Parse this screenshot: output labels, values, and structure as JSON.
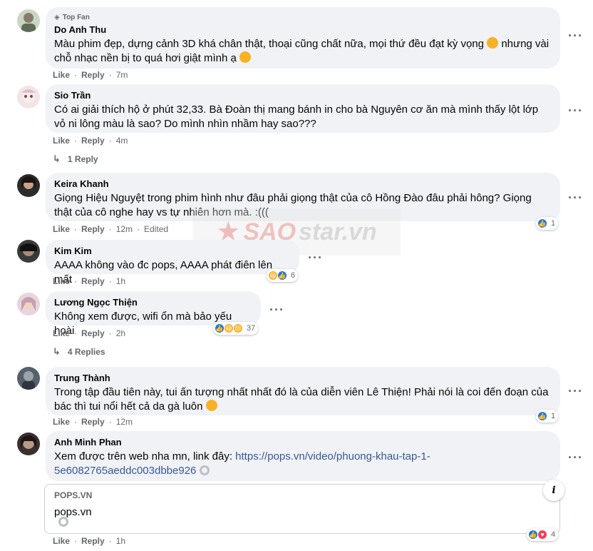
{
  "comments": [
    {
      "badge": "Top Fan",
      "name": "Do Anh Thu",
      "text": "Màu phim đẹp, dựng cảnh 3D khá chân thật, thoại cũng chất nữa, mọi thứ đều đạt kỳ vọng",
      "text2": "nhưng vài chỗ nhạc nền bị to quá hơi giật mình ạ",
      "like": "Like",
      "reply": "Reply",
      "time": "7m"
    },
    {
      "name": "Sio Trần",
      "text": "Có ai giải thích hộ ở phút 32,33. Bà Đoàn thị mang bánh in cho bà Nguyên cơ ăn mà mình thấy lột lớp vỏ ni lông màu là sao? Do mình nhìn nhầm hay sao???",
      "like": "Like",
      "reply": "Reply",
      "time": "4m",
      "replies": "1 Reply"
    },
    {
      "name": "Keira Khanh",
      "text": "Giọng Hiệu Nguyệt trong phim hình như đâu phải giọng thật của cô Hồng Đào đâu phải hông? Giọng thật của cô nghe hay vs tự nhiên hơn mà. :(((",
      "like": "Like",
      "reply": "Reply",
      "time": "12m",
      "edited": "Edited",
      "reactions": "1"
    },
    {
      "name": "Kim Kim",
      "text": "AAAA không vào đc pops, AAAA phát điên lên mất",
      "like": "Like",
      "reply": "Reply",
      "time": "1h",
      "reactions": "6"
    },
    {
      "name": "Lương Ngọc Thiện",
      "text": "Không xem được, wifi ổn mà bảo yếu hoài",
      "like": "Like",
      "reply": "Reply",
      "time": "2h",
      "reactions": "37",
      "replies": "4 Replies"
    },
    {
      "name": "Trung Thành",
      "text": "Trong tập đầu tiên này, tui ấn tượng nhất nhất đó là của diễn viên Lê Thiện! Phải nói là coi đến đoạn của bác thì tui nổi hết cả da gà luôn",
      "like": "Like",
      "reply": "Reply",
      "time": "12m",
      "reactions": "1"
    },
    {
      "name": "Anh Minh Phan",
      "text": "Xem được trên web nha mn, link đây:",
      "link": "https://pops.vn/video/phuong-khau-tap-1-",
      "link2": "5e6082765aeddc003dbbe926",
      "preview_domain": "POPS.VN",
      "preview_title": "pops.vn",
      "like": "Like",
      "reply": "Reply",
      "time": "1h",
      "reactions": "4"
    }
  ],
  "watermark": {
    "part1": "SAO",
    "part2": "star.vn"
  },
  "icons": {
    "more": "more-options-icon",
    "info": "info-icon",
    "reply_arrow": "reply-arrow-icon"
  },
  "colors": {
    "bubble": "#f0f2f5",
    "meta": "#65676b",
    "like": "#1877f2",
    "link": "#385898"
  }
}
